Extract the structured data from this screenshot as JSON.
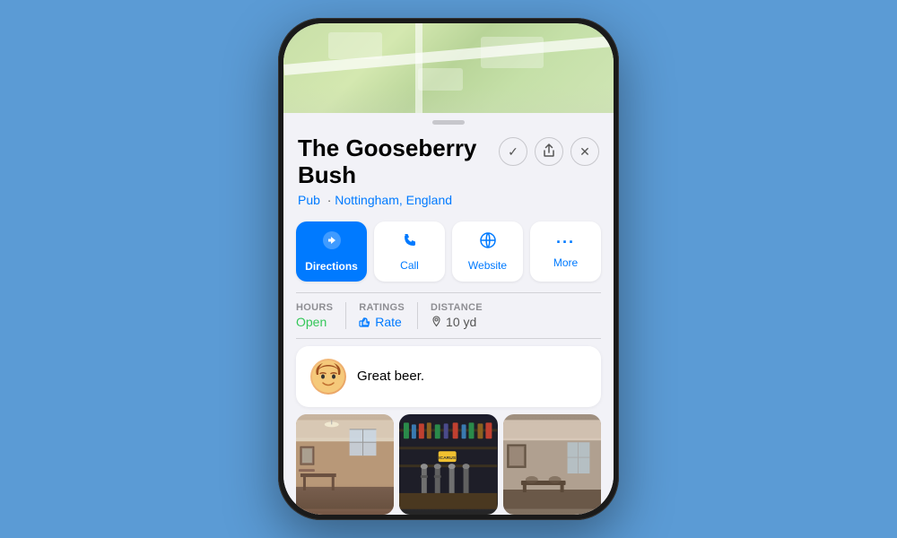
{
  "phone": {
    "place": {
      "name": "The Gooseberry Bush",
      "category": "Pub",
      "location": "Nottingham, England"
    },
    "header_buttons": {
      "checkmark": "✓",
      "share": "⬆",
      "close": "✕"
    },
    "action_buttons": [
      {
        "id": "directions",
        "icon": "➤",
        "label": "Directions",
        "primary": true
      },
      {
        "id": "call",
        "icon": "📞",
        "label": "Call",
        "primary": false
      },
      {
        "id": "website",
        "icon": "🧭",
        "label": "Website",
        "primary": false
      },
      {
        "id": "more",
        "icon": "•••",
        "label": "More",
        "primary": false
      }
    ],
    "info": {
      "hours_label": "HOURS",
      "hours_value": "Open",
      "ratings_label": "RATINGS",
      "ratings_value": "Rate",
      "distance_label": "DISTANCE",
      "distance_value": "10 yd"
    },
    "review": {
      "avatar_emoji": "🧑",
      "text": "Great beer."
    },
    "photos": [
      {
        "id": "photo-interior",
        "description": "Pub interior"
      },
      {
        "id": "photo-bar",
        "description": "Bar taps"
      },
      {
        "id": "photo-room",
        "description": "Pub room"
      }
    ]
  }
}
